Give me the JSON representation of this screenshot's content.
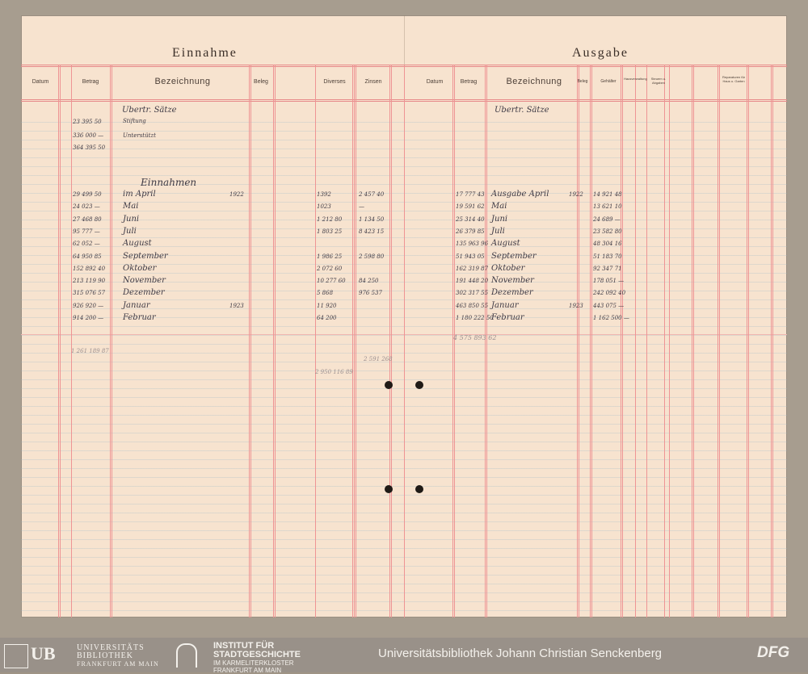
{
  "income": {
    "title": "Einnahme",
    "columns": [
      "Datum",
      "Betrag",
      "Bezeichnung",
      "Beleg",
      "Diverses",
      "Zinsen"
    ],
    "heading": "Einnahmen",
    "carryover_label": "Ubertr. Sätze",
    "carryover": [
      {
        "desc": "Stiftung",
        "amount": "23 395 50"
      },
      {
        "desc": "Unterstützt",
        "amount": "336 000 —"
      },
      {
        "desc": "",
        "amount": "364 395 50"
      }
    ],
    "rows": [
      {
        "month": "im April",
        "year": "1922",
        "amount": "29 499 50",
        "diverses": "1392",
        "zinsen": "2 457 40"
      },
      {
        "month": "Mai",
        "year": "",
        "amount": "24 023 —",
        "diverses": "1023",
        "zinsen": "—"
      },
      {
        "month": "Juni",
        "year": "",
        "amount": "27 468 80",
        "diverses": "1 212 80",
        "zinsen": "1 134 50"
      },
      {
        "month": "Juli",
        "year": "",
        "amount": "95 777 —",
        "diverses": "1 803 25",
        "zinsen": "8 423 15"
      },
      {
        "month": "August",
        "year": "",
        "amount": "62 052 —",
        "diverses": "",
        "zinsen": ""
      },
      {
        "month": "September",
        "year": "",
        "amount": "64 950 85",
        "diverses": "1 986 25",
        "zinsen": "2 598 80"
      },
      {
        "month": "Oktober",
        "year": "",
        "amount": "152 892 40",
        "diverses": "2 072 60",
        "zinsen": ""
      },
      {
        "month": "November",
        "year": "",
        "amount": "213 119 90",
        "diverses": "10 277 60",
        "zinsen": "84 250"
      },
      {
        "month": "Dezember",
        "year": "",
        "amount": "315 076 57",
        "diverses": "5 868",
        "zinsen": "976 537"
      },
      {
        "month": "Januar",
        "year": "1923",
        "amount": "926 920 —",
        "diverses": "11 920",
        "zinsen": ""
      },
      {
        "month": "Februar",
        "year": "",
        "amount": "914 200 —",
        "diverses": "64 200",
        "zinsen": ""
      }
    ],
    "totals": [
      "1 261 189 87",
      "2 591 268",
      "2 950 116 89"
    ]
  },
  "expense": {
    "title": "Ausgabe",
    "columns": [
      "Datum",
      "Betrag",
      "Bezeichnung",
      "Beleg",
      "Gehälter"
    ],
    "small_columns": [
      "Hausverwaltung",
      "Steuern u. Abgaben",
      "Reparaturen für Haus u. Garten"
    ],
    "carryover_label": "Ubertr. Sätze",
    "rows": [
      {
        "month": "Ausgabe April",
        "year": "1922",
        "amount": "17 777 43",
        "salary": "14 921 48"
      },
      {
        "month": "Mai",
        "year": "",
        "amount": "19 591 62",
        "salary": "13 621 10"
      },
      {
        "month": "Juni",
        "year": "",
        "amount": "25 314 40",
        "salary": "24 689 —"
      },
      {
        "month": "Juli",
        "year": "",
        "amount": "26 379 85",
        "salary": "23 582 80"
      },
      {
        "month": "August",
        "year": "",
        "amount": "135 963 96",
        "salary": "48 304 16"
      },
      {
        "month": "September",
        "year": "",
        "amount": "51 943 05",
        "salary": "51 183 70"
      },
      {
        "month": "Oktober",
        "year": "",
        "amount": "162 319 87",
        "salary": "92 347 71"
      },
      {
        "month": "November",
        "year": "",
        "amount": "191 448 20",
        "salary": "178 051 —"
      },
      {
        "month": "Dezember",
        "year": "",
        "amount": "302 317 55",
        "salary": "242 092 40"
      },
      {
        "month": "Januar",
        "year": "1923",
        "amount": "463 850 55",
        "salary": "443 075 —"
      },
      {
        "month": "Februar",
        "year": "",
        "amount": "1 180 222 50",
        "salary": "1 162 500 —"
      }
    ],
    "totals": [
      "4 575 893 62"
    ]
  },
  "footer": {
    "ub_short": "UB",
    "ub_lines": [
      "UNIVERSITÄTS",
      "BIBLIOTHEK",
      "FRANKFURT AM MAIN"
    ],
    "isg_lines": [
      "INSTITUT FÜR",
      "STADTGESCHICHTE",
      "IM KARMELITERKLOSTER",
      "FRANKFURT AM MAIN"
    ],
    "credit": "Universitätsbibliothek Johann Christian Senckenberg",
    "dfg": "DFG"
  },
  "colors": {
    "ruling_red": "#e78a8a",
    "paper": "#f7e3cf",
    "ink": "#3e3a45",
    "footer_bg": "#999189"
  }
}
